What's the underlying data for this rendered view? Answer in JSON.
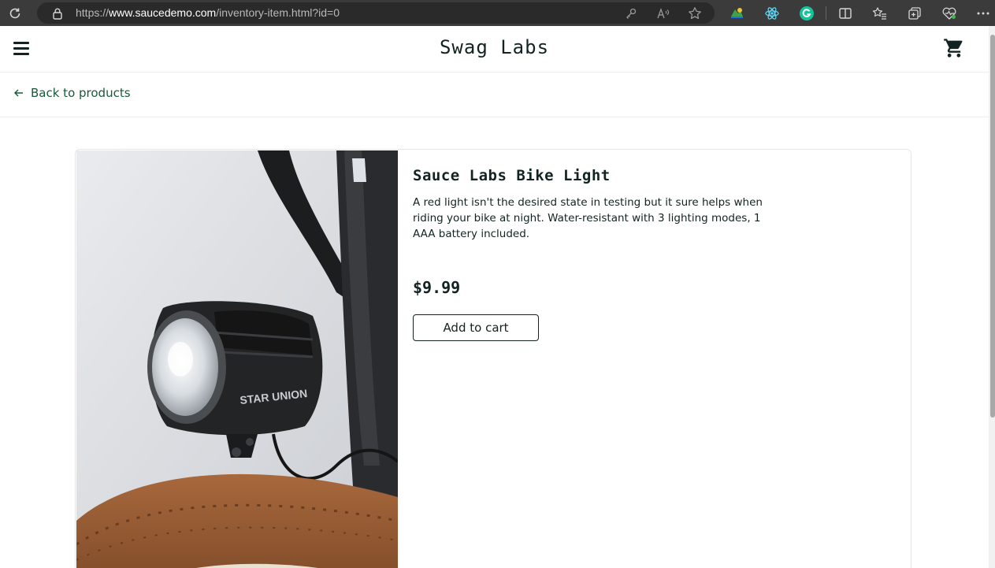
{
  "browser": {
    "url_prefix": "https://",
    "url_host": "www.saucedemo.com",
    "url_path": "/inventory-item.html?id=0"
  },
  "header": {
    "logo": "Swag Labs"
  },
  "nav": {
    "back_label": "Back to products"
  },
  "product": {
    "name": "Sauce Labs Bike Light",
    "description": "A red light isn't the desired state in testing but it sure helps when riding your bike at night. Water-resistant with 3 lighting modes, 1 AAA battery included.",
    "price": "$9.99",
    "add_to_cart_label": "Add to cart",
    "image_brand_text": "STAR UNION"
  },
  "colors": {
    "accent_green": "#18583a",
    "text_dark": "#132322",
    "browser_bar": "#3b3b3b"
  }
}
